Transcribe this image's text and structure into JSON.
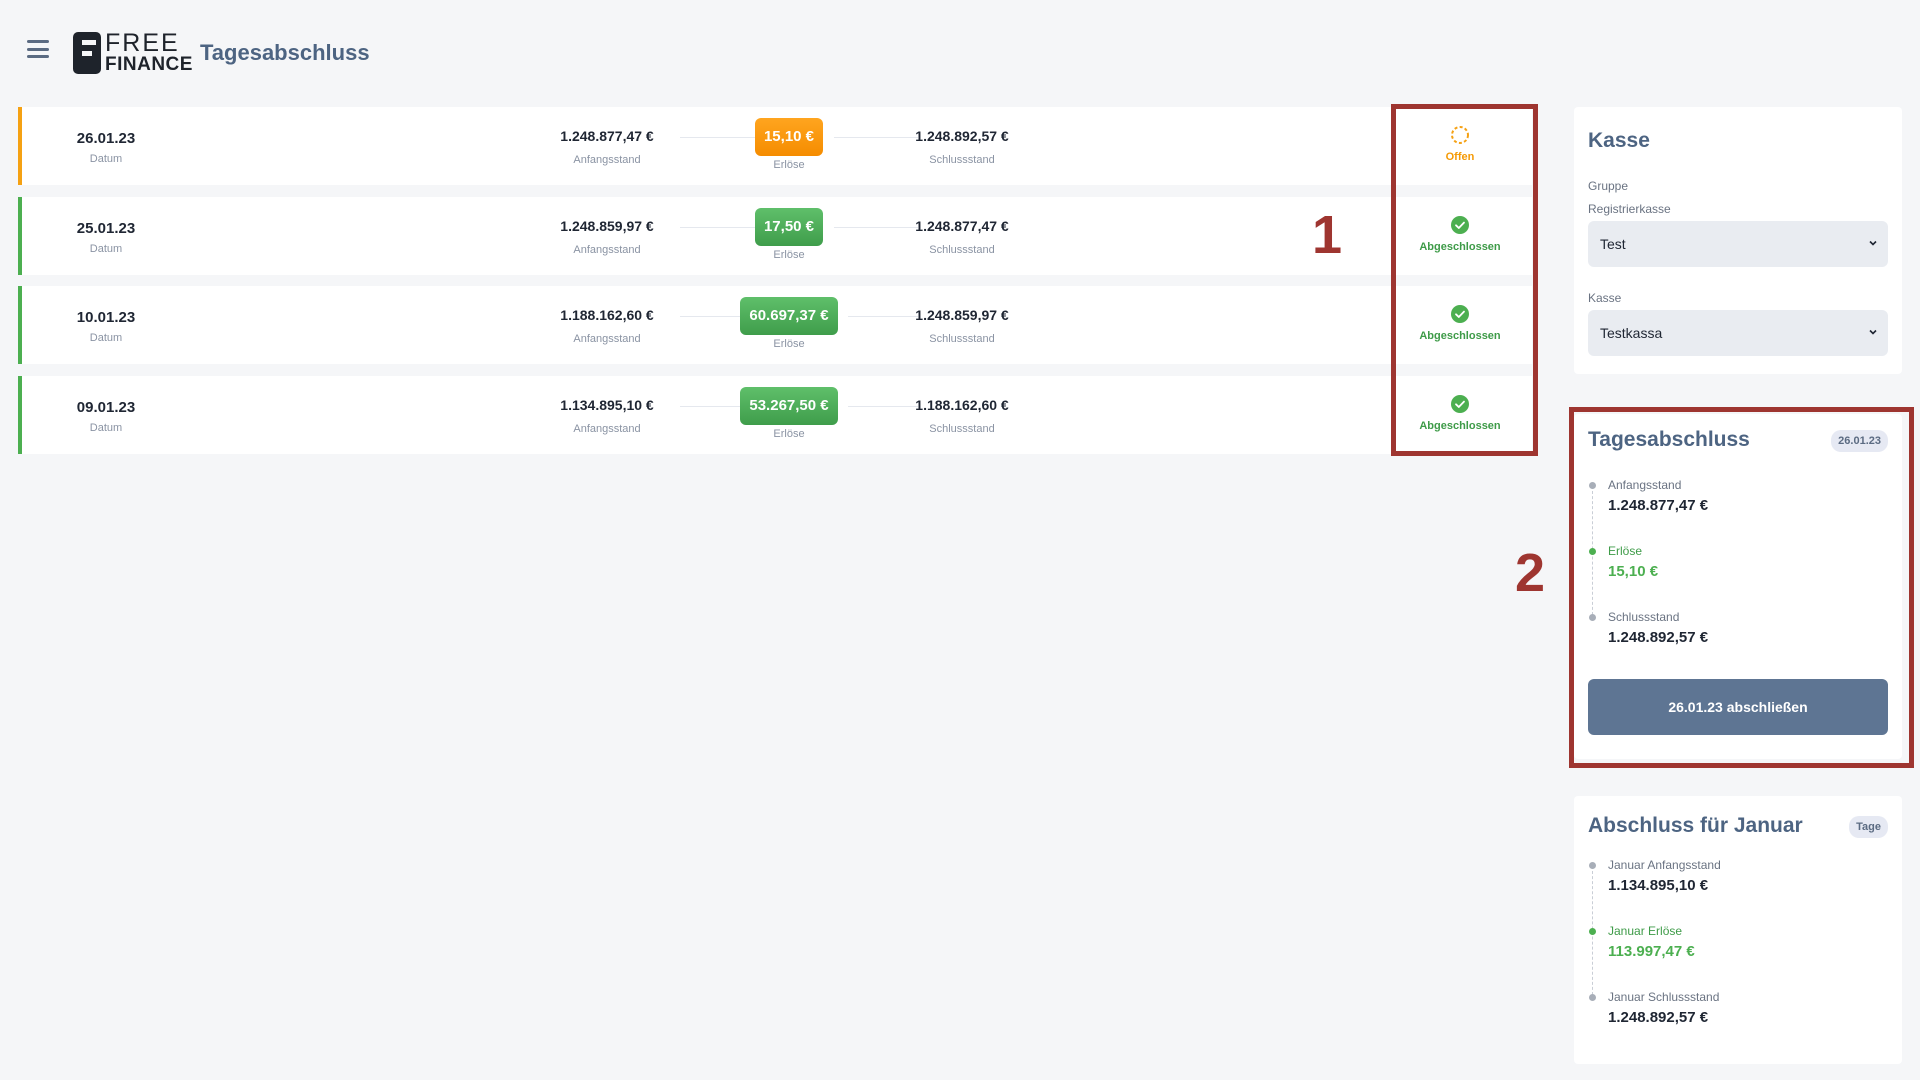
{
  "header": {
    "logo_top": "FREE",
    "logo_bottom": "FINANCE",
    "title": "Tagesabschluss"
  },
  "labels": {
    "date": "Datum",
    "start": "Anfangsstand",
    "revenue": "Erlöse",
    "end": "Schlussstand"
  },
  "rows": [
    {
      "date": "26.01.23",
      "start": "1.248.877,47 €",
      "revenue": "15,10 €",
      "end": "1.248.892,57 €",
      "status": "Offen",
      "state": "open"
    },
    {
      "date": "25.01.23",
      "start": "1.248.859,97 €",
      "revenue": "17,50 €",
      "end": "1.248.877,47 €",
      "status": "Abgeschlossen",
      "state": "closed"
    },
    {
      "date": "10.01.23",
      "start": "1.188.162,60 €",
      "revenue": "60.697,37 €",
      "end": "1.248.859,97 €",
      "status": "Abgeschlossen",
      "state": "closed"
    },
    {
      "date": "09.01.23",
      "start": "1.134.895,10 €",
      "revenue": "53.267,50 €",
      "end": "1.188.162,60 €",
      "status": "Abgeschlossen",
      "state": "closed"
    }
  ],
  "annotations": {
    "one": "1",
    "two": "2"
  },
  "kasse_panel": {
    "title": "Kasse",
    "group_label": "Gruppe",
    "register_label": "Registrierkasse",
    "register_value": "Test",
    "kasse_label": "Kasse",
    "kasse_value": "Testkassa"
  },
  "summary_panel": {
    "title": "Tagesabschluss",
    "badge": "26.01.23",
    "start_label": "Anfangsstand",
    "start_value": "1.248.877,47 €",
    "revenue_label": "Erlöse",
    "revenue_value": "15,10 €",
    "end_label": "Schlussstand",
    "end_value": "1.248.892,57 €",
    "button_label": "26.01.23 abschließen"
  },
  "month_panel": {
    "title": "Abschluss für Januar",
    "badge": "Tage",
    "start_label": "Januar Anfangsstand",
    "start_value": "1.134.895,10 €",
    "revenue_label": "Januar Erlöse",
    "revenue_value": "113.997,47 €",
    "end_label": "Januar Schlussstand",
    "end_value": "1.248.892,57 €"
  },
  "colors": {
    "accent": "#5e7593",
    "open": "#f5a113",
    "closed": "#4caf50",
    "annotation": "#9e3530"
  }
}
